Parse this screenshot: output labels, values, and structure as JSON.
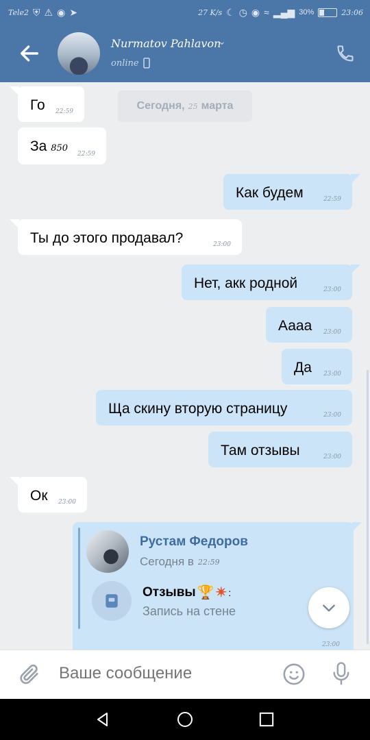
{
  "status_bar": {
    "carrier": "Tele2",
    "speed": "27 K/s",
    "battery_text": "30%",
    "battery_level": 0.3,
    "time": "23:06"
  },
  "header": {
    "contact_name": "Nurmatov Pahlavon",
    "status": "online"
  },
  "date_separator": {
    "label": "Сегодня,",
    "day": "25",
    "month": "марта"
  },
  "messages": [
    {
      "dir": "in",
      "text": "Го",
      "time": "22:59"
    },
    {
      "dir": "in",
      "text": "За",
      "amount": "850",
      "time": "22:59"
    },
    {
      "dir": "out",
      "text": "Как будем",
      "time": "22:59"
    },
    {
      "dir": "in",
      "text": "Ты до этого продавал?",
      "time": "23:00"
    },
    {
      "dir": "out",
      "text": "Нет, акк родной",
      "time": "23:00"
    },
    {
      "dir": "out",
      "text": "Аааа",
      "time": "23:00"
    },
    {
      "dir": "out",
      "text": "Да",
      "time": "23:00"
    },
    {
      "dir": "out",
      "text": "Ща скину вторую страницу",
      "time": "23:00"
    },
    {
      "dir": "out",
      "text": "Там отзывы",
      "time": "23:00"
    },
    {
      "dir": "in",
      "text": "Ок",
      "time": "23:00"
    }
  ],
  "wall_post": {
    "author": "Рустам Федоров",
    "date_prefix": "Сегодня в",
    "date_time": "22:59",
    "title": "Отзывы",
    "title_suffix": ":",
    "subtitle": "Запись на стене",
    "time": "23:00"
  },
  "composer": {
    "placeholder": "Ваше сообщение"
  },
  "colors": {
    "header": "#4a76a8",
    "outgoing_bubble": "#cce4f7",
    "incoming_bubble": "#ffffff",
    "background": "#edeef0"
  }
}
